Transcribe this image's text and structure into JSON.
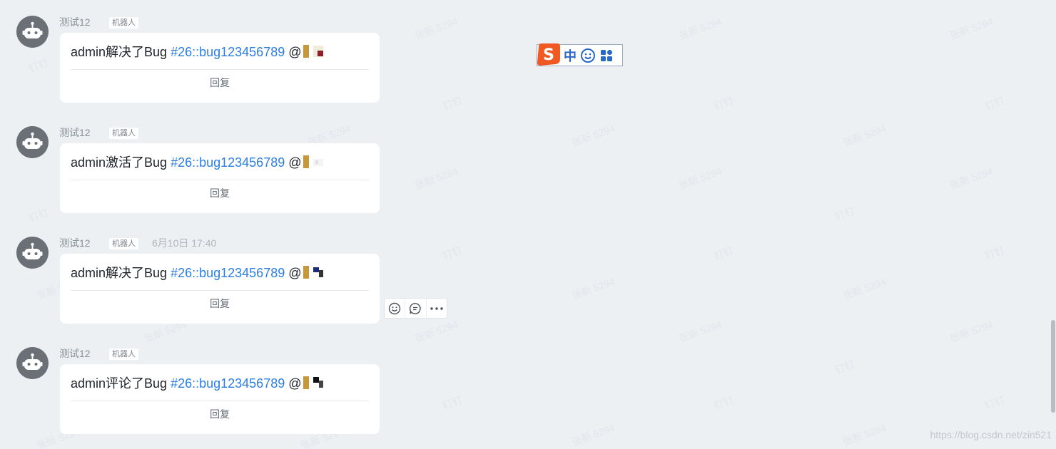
{
  "messages": [
    {
      "sender": "测试12",
      "tag": "机器人",
      "timestamp": "",
      "prefix": "admin解决了Bug ",
      "bug_link": "#26::bug123456789",
      "at": " @",
      "reply": "回复"
    },
    {
      "sender": "测试12",
      "tag": "机器人",
      "timestamp": "",
      "prefix": "admin激活了Bug ",
      "bug_link": "#26::bug123456789",
      "at": " @",
      "reply": "回复"
    },
    {
      "sender": "测试12",
      "tag": "机器人",
      "timestamp": "6月10日 17:40",
      "prefix": "admin解决了Bug ",
      "bug_link": "#26::bug123456789",
      "at": " @",
      "reply": "回复"
    },
    {
      "sender": "测试12",
      "tag": "机器人",
      "timestamp": "",
      "prefix": "admin评论了Bug ",
      "bug_link": "#26::bug123456789",
      "at": " @",
      "reply": "回复"
    }
  ],
  "hover_toolbar": {
    "icons": [
      "emoji-reaction-icon",
      "reply-thread-icon",
      "more-options-icon"
    ]
  },
  "ime": {
    "logo": "S",
    "mode": "中",
    "icons": [
      "smiley-icon",
      "grid-menu-icon"
    ]
  },
  "watermarks": [
    "张新 5294",
    "钉钉"
  ],
  "source_url": "https://blog.csdn.net/zin521",
  "colors": {
    "background": "#edf0f3",
    "bubble": "#ffffff",
    "link": "#2b7ee0",
    "avatar": "#6b7076",
    "ime_logo": "#f05a22",
    "ime_accent": "#2868c7"
  }
}
